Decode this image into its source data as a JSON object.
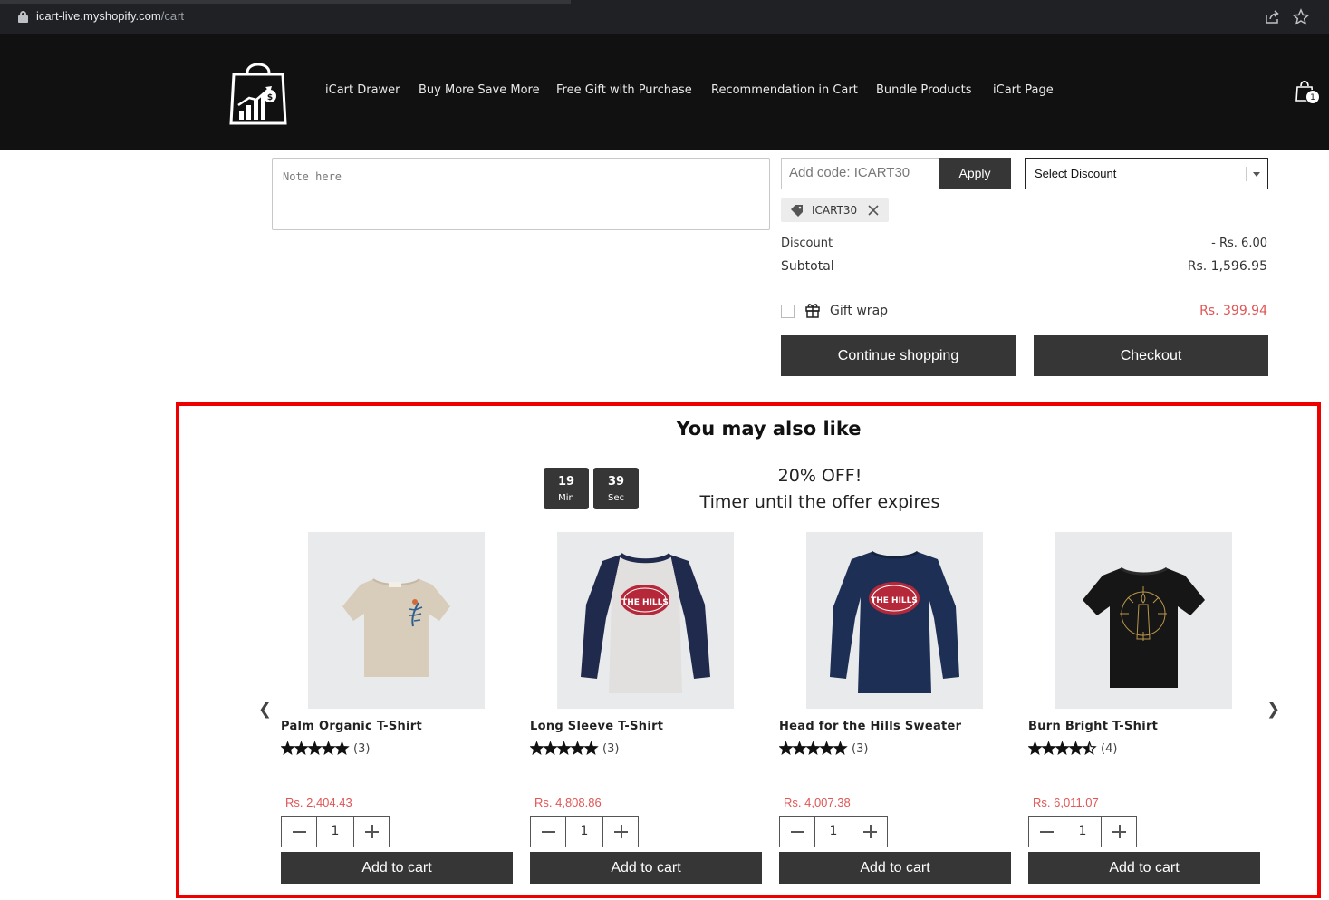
{
  "browser": {
    "url_host": "icart-live.myshopify.com",
    "url_path": "/cart"
  },
  "nav": {
    "items": [
      {
        "label": "iCart Drawer"
      },
      {
        "label": "Buy More Save More"
      },
      {
        "label": "Free Gift with Purchase"
      },
      {
        "label": "Recommendation in Cart"
      },
      {
        "label": "Bundle Products"
      },
      {
        "label": "iCart Page"
      }
    ],
    "cart_count": "1"
  },
  "cart": {
    "note_placeholder": "Note here",
    "code_placeholder": "Add code: ICART30",
    "apply_label": "Apply",
    "select_discount_label": "Select Discount",
    "applied_code": "ICART30",
    "discount_label": "Discount",
    "discount_value": "- Rs. 6.00",
    "subtotal_label": "Subtotal",
    "subtotal_value": "Rs. 1,596.95",
    "giftwrap_label": "Gift wrap",
    "giftwrap_price": "Rs. 399.94",
    "giftwrap_checked": false,
    "continue_label": "Continue shopping",
    "checkout_label": "Checkout"
  },
  "upsell": {
    "title": "You may also like",
    "timer": {
      "minutes": "19",
      "minutes_unit": "Min",
      "seconds": "39",
      "seconds_unit": "Sec"
    },
    "offer_headline": "20% OFF!",
    "offer_subline": "Timer until the offer expires",
    "prev_arrow": "❮",
    "next_arrow": "❯",
    "products": [
      {
        "name": "Palm Organic T-Shirt",
        "rating": 5,
        "reviews": "(3)",
        "price": "Rs. 2,404.43",
        "qty": "1",
        "add_label": "Add to cart",
        "image": "beige-tshirt-with-palm-leaf"
      },
      {
        "name": "Long Sleeve T-Shirt",
        "rating": 5,
        "reviews": "(3)",
        "price": "Rs. 4,808.86",
        "qty": "1",
        "add_label": "Add to cart",
        "image": "raglan-long-sleeve-the-hills"
      },
      {
        "name": "Head for the Hills Sweater",
        "rating": 5,
        "reviews": "(3)",
        "price": "Rs. 4,007.38",
        "qty": "1",
        "add_label": "Add to cart",
        "image": "navy-sweater-the-hills"
      },
      {
        "name": "Burn Bright T-Shirt",
        "rating": 4.5,
        "reviews": "(4)",
        "price": "Rs. 6,011.07",
        "qty": "1",
        "add_label": "Add to cart",
        "image": "black-tshirt-burn-bright"
      }
    ],
    "colors": {
      "accent_border": "#ee0000",
      "button_bg": "#363636",
      "price": "#e05555"
    }
  }
}
